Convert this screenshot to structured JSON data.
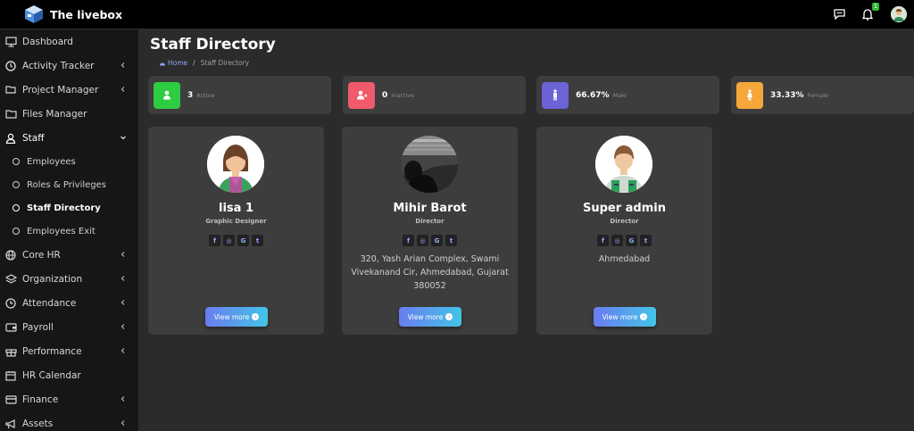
{
  "brand": {
    "name": "The livebox"
  },
  "topbar": {
    "notification_count": "1"
  },
  "sidebar": {
    "items": [
      {
        "label": "Dashboard"
      },
      {
        "label": "Activity Tracker"
      },
      {
        "label": "Project Manager"
      },
      {
        "label": "Files Manager"
      },
      {
        "label": "Staff"
      },
      {
        "label": "Core HR"
      },
      {
        "label": "Organization"
      },
      {
        "label": "Attendance"
      },
      {
        "label": "Payroll"
      },
      {
        "label": "Performance"
      },
      {
        "label": "HR Calendar"
      },
      {
        "label": "Finance"
      },
      {
        "label": "Assets"
      }
    ],
    "staff_sub": [
      {
        "label": "Employees"
      },
      {
        "label": "Roles & Privileges"
      },
      {
        "label": "Staff Directory"
      },
      {
        "label": "Employees Exit"
      }
    ]
  },
  "page": {
    "title": "Staff Directory",
    "breadcrumb": {
      "home": "Home",
      "current": "Staff Directory"
    }
  },
  "stats": [
    {
      "value": "3",
      "label": "Active",
      "color": "#2ecc40",
      "icon": "user-icon"
    },
    {
      "value": "0",
      "label": "Inactive",
      "color": "#f05a6a",
      "icon": "user-x-icon"
    },
    {
      "value": "66.67%",
      "label": "Male",
      "color": "#6c63d6",
      "icon": "male-icon"
    },
    {
      "value": "33.33%",
      "label": "Female",
      "color": "#f7a63a",
      "icon": "female-icon"
    }
  ],
  "staff": [
    {
      "name": "lisa 1",
      "role": "Graphic Designer",
      "address": "",
      "button": "View more"
    },
    {
      "name": "Mihir Barot",
      "role": "Director",
      "address": "320, Yash Arian Complex, Swami Vivekanand Cir, Ahmedabad, Gujarat 380052",
      "button": "View more"
    },
    {
      "name": "Super admin",
      "role": "Director",
      "address": "Ahmedabad",
      "button": "View more"
    }
  ],
  "socials": {
    "facebook": "f",
    "instagram": "◎",
    "google": "G",
    "twitter": "t"
  }
}
